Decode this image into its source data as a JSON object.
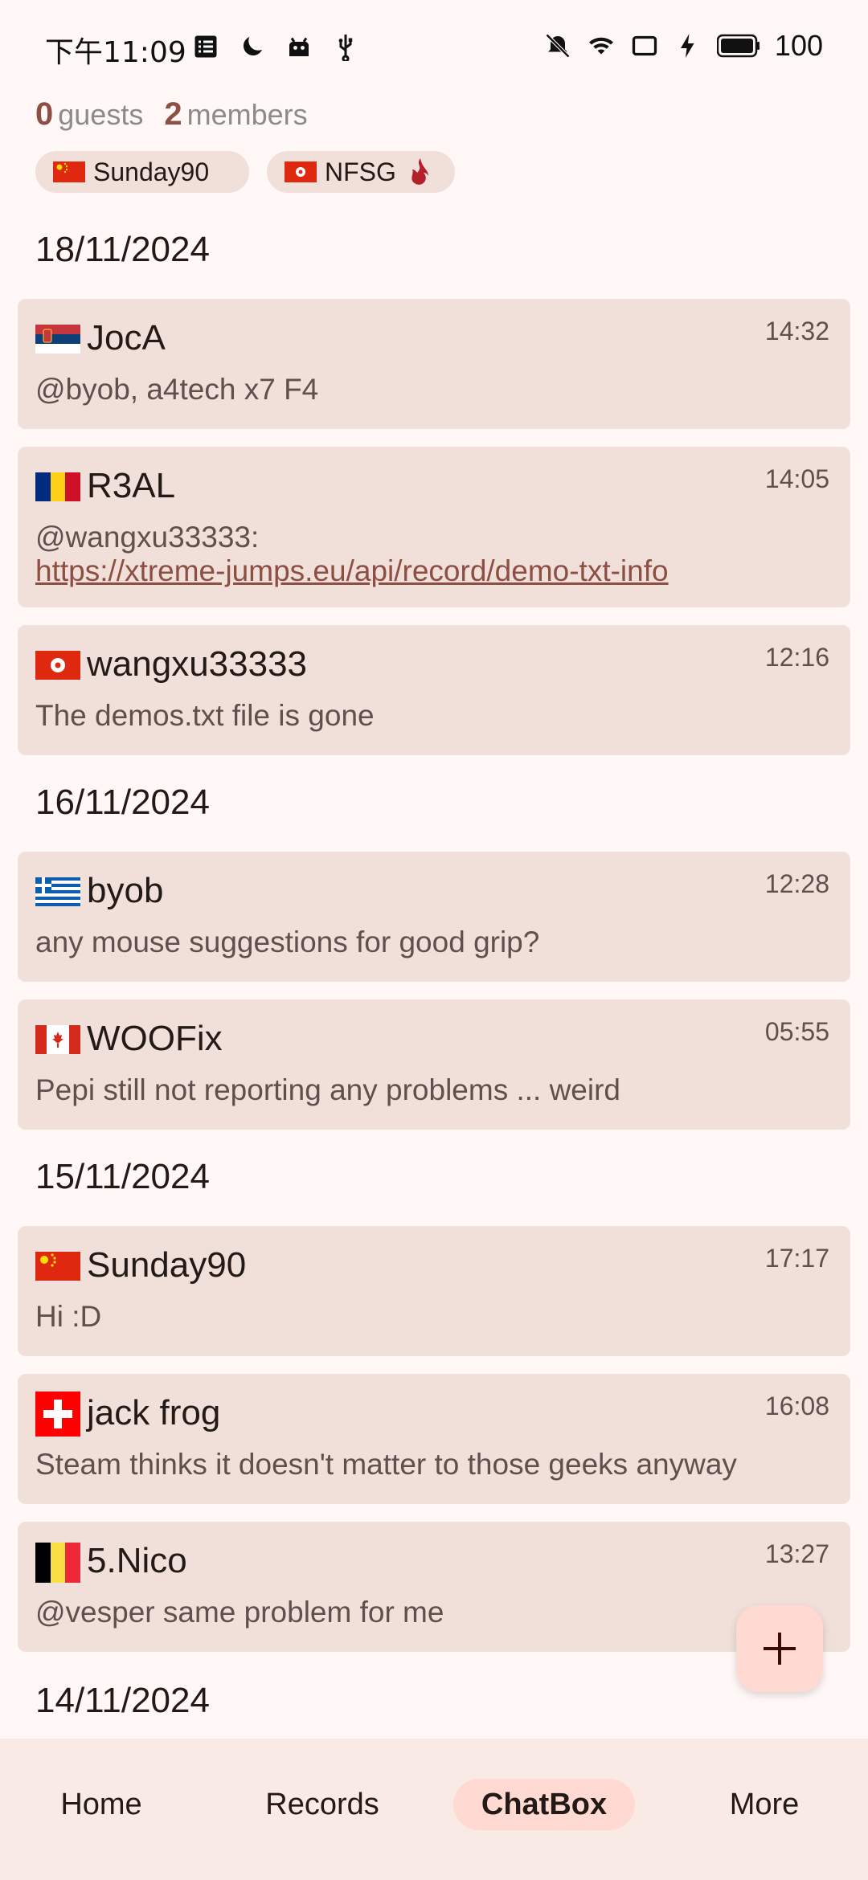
{
  "status": {
    "time": "下午11:09",
    "battery": "100"
  },
  "counts": {
    "guests_num": "0",
    "guests_label": "guests",
    "members_num": "2",
    "members_label": "members"
  },
  "online": [
    {
      "name": "Sunday90",
      "flag": "cn"
    },
    {
      "name": "NFSG",
      "flag": "hk"
    }
  ],
  "groups": [
    {
      "date": "18/11/2024",
      "messages": [
        {
          "name": "JocA",
          "flag": "rs",
          "time": "14:32",
          "text": "@byob, a4tech x7 F4"
        },
        {
          "name": "R3AL",
          "flag": "ro",
          "time": "14:05",
          "text": "@wangxu33333:",
          "link": "https://xtreme-jumps.eu/api/record/demo-txt-info"
        },
        {
          "name": "wangxu33333",
          "flag": "hk",
          "time": "12:16",
          "text": "The demos.txt file is gone"
        }
      ]
    },
    {
      "date": "16/11/2024",
      "messages": [
        {
          "name": "byob",
          "flag": "gr",
          "time": "12:28",
          "text": "any mouse suggestions for good grip?"
        },
        {
          "name": "WOOFix",
          "flag": "ca",
          "time": "05:55",
          "text": "Pepi still not reporting any problems ... weird"
        }
      ]
    },
    {
      "date": "15/11/2024",
      "messages": [
        {
          "name": "Sunday90",
          "flag": "cn",
          "time": "17:17",
          "text": "Hi :D"
        },
        {
          "name": "jack frog",
          "flag": "ch",
          "time": "16:08",
          "text": "Steam thinks it doesn't matter to those geeks anyway"
        },
        {
          "name": "5.Nico",
          "flag": "be",
          "time": "13:27",
          "text": "@vesper same problem for me"
        }
      ]
    },
    {
      "date": "14/11/2024",
      "messages": []
    }
  ],
  "nav": {
    "home": "Home",
    "records": "Records",
    "chatbox": "ChatBox",
    "more": "More"
  }
}
